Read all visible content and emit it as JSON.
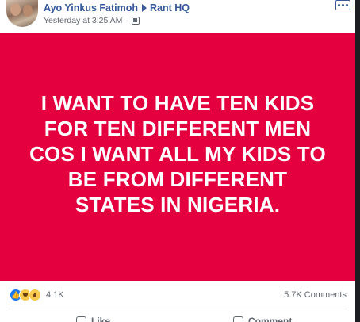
{
  "post": {
    "author": "Ayo Yinkus Fatimoh",
    "group": "Rant HQ",
    "timestamp": "Yesterday at 3:25 AM",
    "separator": "·",
    "audience_icon": "group-audience-icon",
    "image": {
      "background_color": "#e4003f",
      "text_color": "#ffffff",
      "lines": [
        "I WANT TO HAVE TEN KIDS",
        "FOR TEN DIFFERENT MEN",
        "COS I WANT ALL MY KIDS TO",
        "BE FROM DIFFERENT",
        "STATES IN NIGERIA."
      ]
    },
    "reactions": {
      "icons": [
        "like-reaction-icon",
        "haha-reaction-icon",
        "wow-reaction-icon"
      ],
      "count": "4.1K"
    },
    "comments_count": "5.7K Comments",
    "actions": {
      "like_label": "Like",
      "comment_label": "Comment"
    }
  },
  "colors": {
    "link_blue": "#365899",
    "meta_gray": "#616770",
    "image_red": "#e4003f"
  }
}
